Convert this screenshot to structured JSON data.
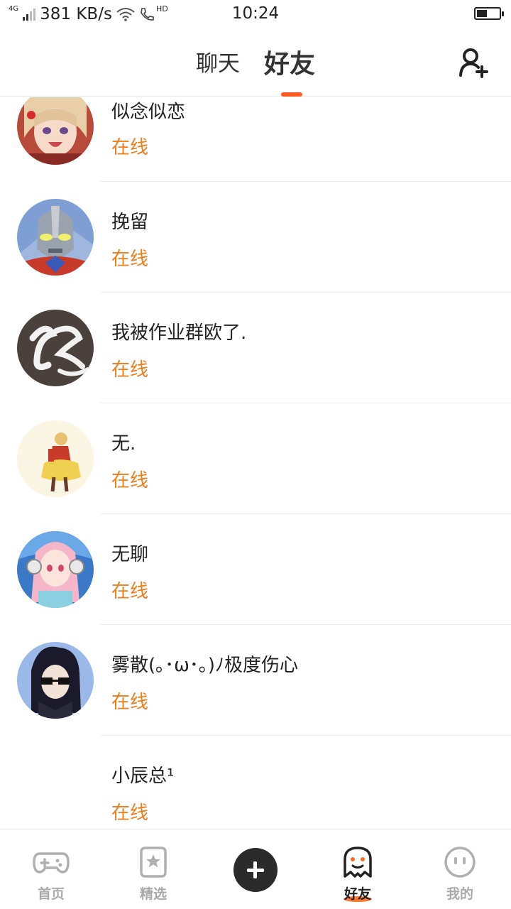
{
  "status_bar": {
    "network": "4G",
    "speed": "381 KB/s",
    "call_badge": "HD",
    "time": "10:24",
    "battery_level": 0.45
  },
  "header": {
    "tabs": [
      {
        "label": "聊天",
        "active": false
      },
      {
        "label": "好友",
        "active": true
      }
    ],
    "add_friend_icon": "add-user-icon"
  },
  "friends": [
    {
      "name": "似念似恋",
      "status": "在线",
      "avatar": "anime-girl-avatar"
    },
    {
      "name": "挽留",
      "status": "在线",
      "avatar": "ultraman-avatar"
    },
    {
      "name": "我被作业群欧了.",
      "status": "在线",
      "avatar": "calligraphy-avatar"
    },
    {
      "name": "无.",
      "status": "在线",
      "avatar": "pixel-character-avatar"
    },
    {
      "name": "无聊",
      "status": "在线",
      "avatar": "pink-hair-headphones-avatar"
    },
    {
      "name": "雾散(｡･ω･｡)ﾉ极度伤心",
      "status": "在线",
      "avatar": "sunglasses-anime-avatar"
    },
    {
      "name": "小辰总¹",
      "status": "在线",
      "avatar": ""
    }
  ],
  "bottom_nav": {
    "items": [
      {
        "label": "首页",
        "icon": "gamepad-icon",
        "active": false
      },
      {
        "label": "精选",
        "icon": "star-bookmark-icon",
        "active": false
      },
      {
        "label": "",
        "icon": "plus-icon",
        "active": false
      },
      {
        "label": "好友",
        "icon": "ghost-icon",
        "active": true
      },
      {
        "label": "我的",
        "icon": "smiley-face-icon",
        "active": false
      }
    ]
  },
  "colors": {
    "accent": "#ff5a1f",
    "online": "#f07d1a",
    "inactive_nav": "#aaaaaa"
  }
}
